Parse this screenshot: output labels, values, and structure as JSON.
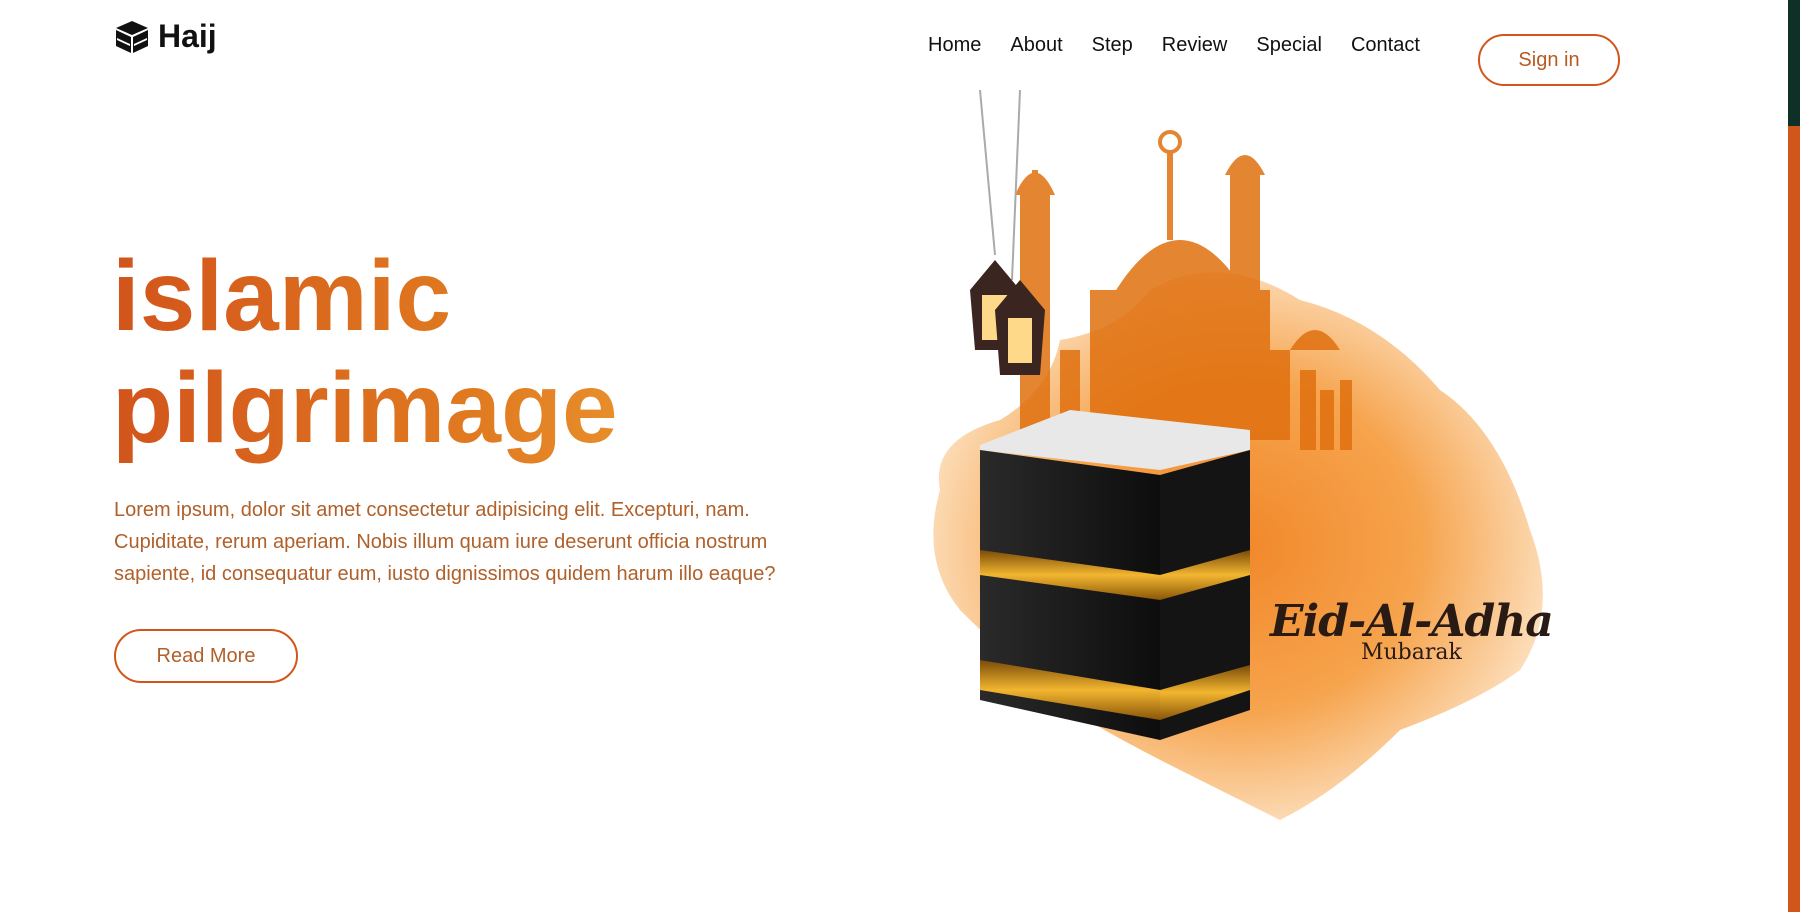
{
  "brand": {
    "name": "Haij",
    "icon": "kaaba-icon"
  },
  "nav": {
    "links": [
      "Home",
      "About",
      "Step",
      "Review",
      "Special",
      "Contact"
    ],
    "signin_label": "Sign in"
  },
  "hero": {
    "title_line1": "islamic",
    "title_line2": "pilgrimage",
    "description": "Lorem ipsum, dolor sit amet consectetur adipisicing elit. Excepturi, nam. Cupiditate, rerum aperiam. Nobis illum quam iure deserunt officia nostrum sapiente, id consequatur eum, iusto dignissimos quidem harum illo eaque?",
    "cta_label": "Read More"
  },
  "illustration": {
    "greeting_title": "Eid-Al-Adha",
    "greeting_subtitle": "Mubarak"
  },
  "colors": {
    "accent": "#d2551c",
    "text_muted": "#b0602a",
    "scroll_thumb": "#0f3027"
  }
}
